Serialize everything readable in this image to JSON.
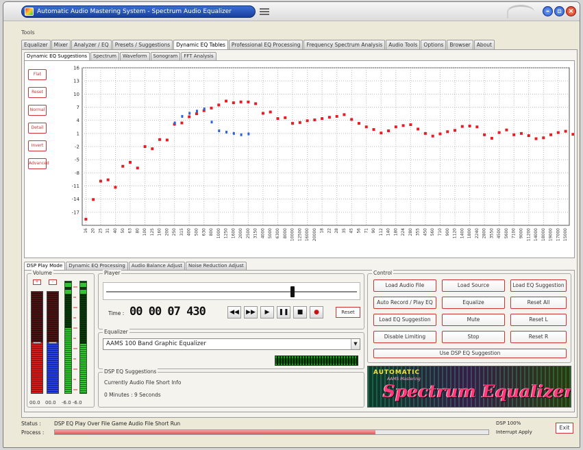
{
  "window": {
    "title": "Automatic Audio Mastering System - Spectrum Audio Equalizer"
  },
  "menu": {
    "label": "Tools"
  },
  "top_tabs": [
    "Equalizer",
    "Mixer",
    "Analyzer / EQ",
    "Presets / Suggestions",
    "Dynamic EQ Tables",
    "Professional EQ Processing",
    "Frequency Spectrum Analysis",
    "Audio Tools",
    "Options",
    "Browser",
    "About"
  ],
  "top_tab_active": 4,
  "sub_tabs": [
    "Dynamic EQ Suggestions",
    "Spectrum",
    "Waveform",
    "Sonogram",
    "FFT Analysis"
  ],
  "side_buttons": [
    "Flat",
    "Reset",
    "Normal",
    "Detail",
    "Invert",
    "Advanced"
  ],
  "lower_tabs": [
    "DSP Play Mode",
    "Dynamic EQ Processing",
    "Audio Balance Adjust",
    "Noise Reduction Adjust"
  ],
  "volume": {
    "title": "Volume",
    "left_tag": "+",
    "right_tag": "-",
    "left_val": "00.0",
    "right_val": "00.0",
    "meter_val": "-6.0 -6.0",
    "left_level": 0.5,
    "right_level": 0.5,
    "meter_left": 0.58,
    "meter_right": 0.44
  },
  "player": {
    "title": "Player",
    "time_label": "Time :",
    "time": "00 00 07 430",
    "position": 0.74,
    "reset_label": "Reset",
    "controls": [
      "◀◀",
      "▶▶",
      "▶",
      "❚❚",
      "■",
      "●"
    ]
  },
  "equalizer": {
    "title": "Equalizer",
    "selected": "AAMS 100 Band Graphic Equalizer",
    "arrow": "▼"
  },
  "info": {
    "title": "DSP EQ Suggestions",
    "line1": "Currently Audio File Short Info",
    "line2": "0 Minutes : 9 Seconds"
  },
  "control": {
    "title": "Control",
    "buttons": [
      [
        "Load Audio File",
        "Load Source",
        "Load EQ Suggestion"
      ],
      [
        "Auto Record / Play EQ",
        "Equalize",
        "Reset All"
      ],
      [
        "Load EQ Suggestion",
        "Mute",
        "Reset L"
      ],
      [
        "Disable Limiting",
        "Stop",
        "Reset R"
      ]
    ],
    "wide_button": "Use DSP EQ Suggestion"
  },
  "banner": {
    "line1": "AUTOMATIC",
    "line2": "AAMS Mastering",
    "title": "Spectrum Equalizer"
  },
  "status": {
    "label": "Status :",
    "text": "DSP EQ Play Over File Game Audio File Short Run",
    "process_label": "Process :",
    "progress": 0.74,
    "right1": "DSP 100%",
    "right2": "Interrupt Apply",
    "exit_label": "Exit"
  },
  "chart_data": {
    "type": "scatter",
    "title": "",
    "xlabel": "",
    "ylabel": "",
    "ylim": [
      -20,
      16
    ],
    "y_ticks": [
      16,
      13,
      10,
      7,
      4,
      1,
      -2,
      -5,
      -8,
      -11,
      -14,
      -17
    ],
    "grid": true,
    "colors": {
      "red": "#e41e26",
      "blue": "#2f63d6"
    },
    "categories": [
      "16",
      "20",
      "25",
      "31",
      "40",
      "50",
      "63",
      "80",
      "100",
      "125",
      "160",
      "200",
      "250",
      "315",
      "400",
      "500",
      "630",
      "800",
      "1000",
      "1250",
      "1600",
      "2000",
      "2500",
      "3150",
      "4000",
      "5000",
      "6300",
      "8000",
      "10000",
      "12500",
      "16000",
      "20000",
      "18",
      "22",
      "28",
      "35",
      "45",
      "56",
      "71",
      "90",
      "112",
      "140",
      "180",
      "224",
      "280",
      "355",
      "450",
      "560",
      "710",
      "900",
      "1120",
      "1400",
      "1800",
      "2240",
      "2800",
      "3550",
      "4500",
      "5600",
      "7100",
      "9000",
      "11200",
      "14000",
      "18000",
      "19000",
      "17000",
      "15000"
    ],
    "series": [
      {
        "values": [
          -18.6,
          -14.1,
          -9.9,
          -9.6,
          -11.3,
          -6.5,
          -5.6,
          -6.9,
          -2.0,
          -2.5,
          -0.4,
          -0.5,
          3.1,
          3.4,
          4.8,
          5.5,
          6.2,
          6.8,
          7.5,
          8.4,
          8.0,
          8.2,
          8.2,
          7.8,
          5.6,
          5.9,
          4.4,
          4.6,
          3.3,
          3.5,
          3.9,
          4.1,
          4.4,
          4.7,
          4.9,
          5.3,
          4.2,
          3.3,
          2.5,
          1.9,
          1.1,
          1.6,
          2.5,
          2.8,
          3.0,
          2.0,
          1.0,
          0.4,
          0.9,
          1.4,
          1.7,
          2.6,
          2.7,
          2.5,
          0.7,
          -0.1,
          1.2,
          1.8,
          0.7,
          1.0,
          0.5,
          -0.2,
          0.0,
          0.7,
          1.2,
          1.5,
          0.8,
          -0.2,
          -0.7,
          1.5,
          2.7
        ]
      },
      {
        "values": [
          3.4,
          4.9,
          5.6,
          6.1,
          6.6,
          3.6,
          1.6,
          1.3,
          1.0,
          0.7,
          0.9
        ]
      }
    ]
  }
}
